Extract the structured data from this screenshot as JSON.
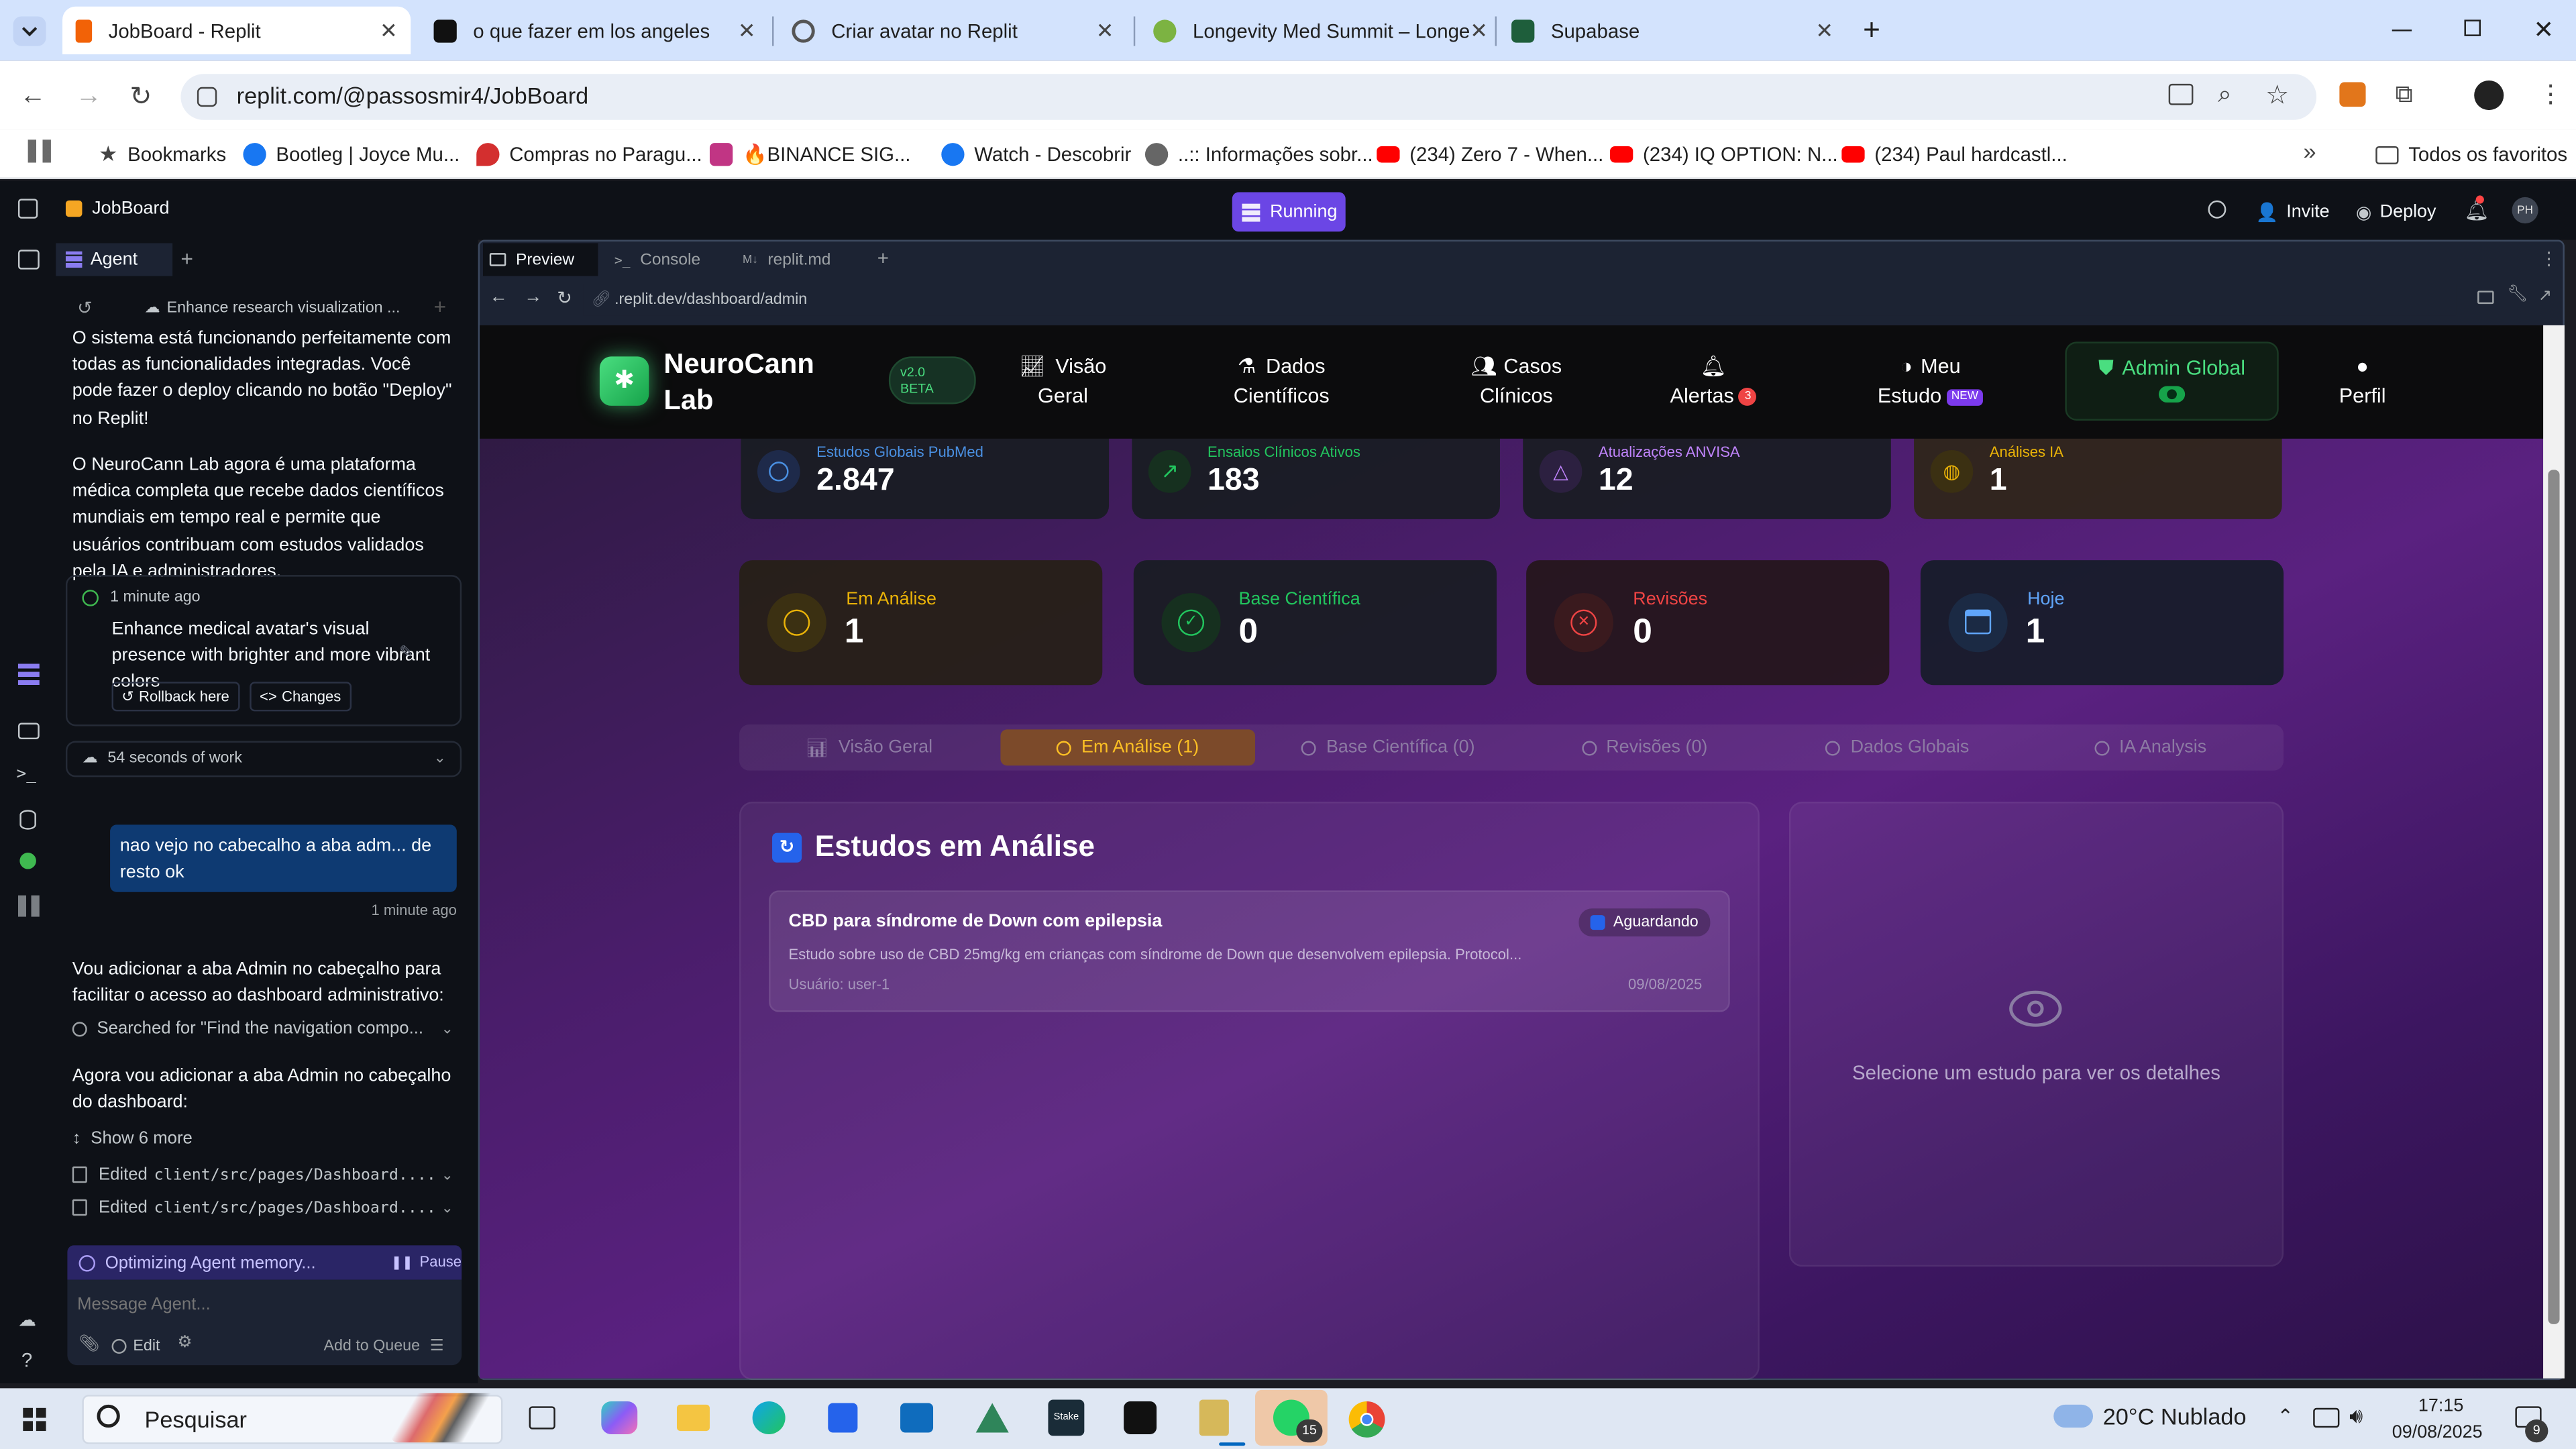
{
  "browser": {
    "tabs": [
      {
        "title": "JobBoard - Replit",
        "active": true,
        "fav_color": "#f26207"
      },
      {
        "title": "o que fazer em los angeles",
        "active": false,
        "fav_color": "#111111"
      },
      {
        "title": "Criar avatar no Replit",
        "active": false,
        "fav_color": "#555555"
      },
      {
        "title": "Longevity Med Summit – Longe",
        "active": false,
        "fav_color": "#7cb342"
      },
      {
        "title": "Supabase",
        "active": false,
        "fav_color": "#1e5e3b"
      }
    ],
    "url": "replit.com/@passosmir4/JobBoard",
    "bookmarks_label": "Bookmarks",
    "bookmarks": [
      {
        "label": "Bootleg | Joyce Mu...",
        "color": "#1877f2"
      },
      {
        "label": "Compras no Paragu...",
        "color": "#d32f2f"
      },
      {
        "label": "🔥BINANCE SIG...",
        "color": "#c13584"
      },
      {
        "label": "Watch - Descobrir",
        "color": "#1877f2"
      },
      {
        "label": "..:: Informações sobr...",
        "color": "#555555"
      },
      {
        "label": "(234) Zero 7 - When...",
        "color": "#ff0000"
      },
      {
        "label": "(234) IQ OPTION: N...",
        "color": "#ff0000"
      },
      {
        "label": "(234) Paul hardcastl...",
        "color": "#ff0000"
      }
    ],
    "all_bookmarks": "Todos os favoritos"
  },
  "replit": {
    "project": "JobBoard",
    "running": "Running",
    "invite": "Invite",
    "deploy": "Deploy",
    "avatar": "PH"
  },
  "agent": {
    "tab": "Agent",
    "thread_title": "Enhance research visualization ...",
    "msg1": "O sistema está funcionando perfeitamente com todas as funcionalidades integradas. Você pode fazer o deploy clicando no botão \"Deploy\" no Replit!",
    "msg2": "O NeuroCann Lab agora é uma plataforma médica completa que recebe dados científicos mundiais em tempo real e permite que usuários contribuam com estudos validados pela IA e administradores.",
    "checkpoint_time": "1 minute ago",
    "checkpoint_text": "Enhance medical avatar's visual presence with brighter and more vibrant colors",
    "rollback": "Rollback here",
    "changes": "Changes",
    "work_time": "54 seconds of work",
    "user_msg": "nao vejo no cabecalho a aba adm... de resto ok",
    "user_msg_time": "1 minute ago",
    "msg3": "Vou adicionar a aba Admin no cabeçalho para facilitar o acesso ao dashboard administrativo:",
    "search_action": "Searched for \"Find the navigation compo...",
    "msg4": "Agora vou adicionar a aba Admin no cabeçalho do dashboard:",
    "show_more": "Show 6 more",
    "edit_prefix": "Edited",
    "edit1": "client/src/pages/Dashboard....",
    "edit2": "client/src/pages/Dashboard....",
    "status": "Optimizing Agent memory...",
    "pause": "Pause",
    "input_placeholder": "Message Agent...",
    "edit_btn": "Edit",
    "queue_btn": "Add to Queue"
  },
  "workspace": {
    "tabs": [
      "Preview",
      "Console",
      "replit.md"
    ],
    "preview_url": ".replit.dev/dashboard/admin"
  },
  "site": {
    "brand_line1": "NeuroCann",
    "brand_line2": "Lab",
    "version_line1": "v2.0",
    "version_line2": "BETA",
    "nav": [
      {
        "l1": "Visão",
        "l2": "Geral",
        "icon": "chart-line-icon"
      },
      {
        "l1": "Dados",
        "l2": "Científicos",
        "icon": "flask-icon"
      },
      {
        "l1": "Casos",
        "l2": "Clínicos",
        "icon": "users-icon"
      },
      {
        "l1": "Alertas",
        "l2": "",
        "icon": "bell-icon",
        "badge": "3"
      },
      {
        "l1": "Meu",
        "l2": "Estudo",
        "icon": "brain-icon",
        "badge": "NEW"
      },
      {
        "l1": "Admin Global",
        "l2": "",
        "icon": "shield-icon"
      },
      {
        "l1": "",
        "l2": "Perfil",
        "icon": "user-icon"
      }
    ],
    "top_stats": [
      {
        "label": "Estudos Globais PubMed",
        "value": "2.847",
        "color": "#4a90e2"
      },
      {
        "label": "Ensaios Clínicos Ativos",
        "value": "183",
        "color": "#22c55e"
      },
      {
        "label": "Atualizações ANVISA",
        "value": "12",
        "color": "#c084fc"
      },
      {
        "label": "Análises IA",
        "value": "1",
        "color": "#eab308"
      }
    ],
    "stats": [
      {
        "label": "Em Análise",
        "value": "1",
        "color": "#eab308"
      },
      {
        "label": "Base Científica",
        "value": "0",
        "color": "#22c55e"
      },
      {
        "label": "Revisões",
        "value": "0",
        "color": "#ef4444"
      },
      {
        "label": "Hoje",
        "value": "1",
        "color": "#60a5fa"
      }
    ],
    "tabs": [
      "Visão Geral",
      "Em Análise (1)",
      "Base Científica (0)",
      "Revisões (0)",
      "Dados Globais",
      "IA Analysis"
    ],
    "active_tab": 1,
    "section_title": "Estudos em Análise",
    "study": {
      "title": "CBD para síndrome de Down com epilepsia",
      "status": "Aguardando",
      "desc": "Estudo sobre uso de CBD 25mg/kg em crianças com síndrome de Down que desenvolvem epilepsia. Protocol...",
      "user": "Usuário: user-1",
      "date": "09/08/2025"
    },
    "detail_empty": "Selecione um estudo para ver os detalhes"
  },
  "taskbar": {
    "search": "Pesquisar",
    "weather": "20°C  Nublado",
    "time": "17:15",
    "date": "09/08/2025",
    "whatsapp_badge": "15",
    "notif_badge": "9"
  }
}
